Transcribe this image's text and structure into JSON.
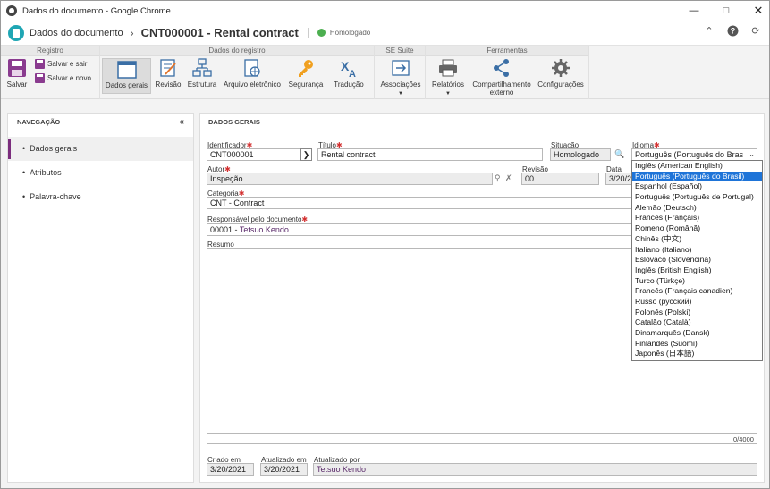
{
  "window": {
    "title": "Dados do documento - Google Chrome"
  },
  "header": {
    "app_name": "Dados do documento",
    "doc_title": "CNT000001 - Rental contract",
    "status": "Homologado"
  },
  "ribbon": {
    "groups": {
      "registro": "Registro",
      "dados": "Dados do registro",
      "suite": "SE Suite",
      "ferramentas": "Ferramentas"
    },
    "save": "Salvar",
    "save_exit": "Salvar e sair",
    "save_new": "Salvar e novo",
    "general": "Dados gerais",
    "revision": "Revisão",
    "structure": "Estrutura",
    "electronic_file": "Arquivo eletrônico",
    "security": "Segurança",
    "translation": "Tradução",
    "associations": "Associações",
    "reports": "Relatórios",
    "sharing_line1": "Compartilhamento",
    "sharing_line2": "externo",
    "settings": "Configurações"
  },
  "nav": {
    "title": "NAVEGAÇÃO",
    "items": [
      "Dados gerais",
      "Atributos",
      "Palavra-chave"
    ]
  },
  "form": {
    "section_title": "DADOS GERAIS",
    "identifier_label": "Identificador",
    "identifier": "CNT000001",
    "title_label": "Título",
    "title": "Rental contract",
    "situation_label": "Situação",
    "situation": "Homologado",
    "language_label": "Idioma",
    "language": "Português (Português do Bras",
    "author_label": "Autor",
    "author": "Inspeção",
    "revision_label": "Revisão",
    "revision": "00",
    "date_label": "Data",
    "date": "3/20/2",
    "category_label": "Categoria",
    "category": "CNT - Contract",
    "responsible_label": "Responsável pelo documento",
    "responsible_code": "00001 - ",
    "responsible_name": "Tetsuo Kendo",
    "summary_label": "Resumo",
    "summary_counter": "0/4000",
    "created_label": "Criado em",
    "created": "3/20/2021",
    "updated_label": "Atualizado em",
    "updated": "3/20/2021",
    "updated_by_label": "Atualizado por",
    "updated_by": "Tetsuo Kendo"
  },
  "language_options": [
    "Inglês (American English)",
    "Português (Português do Brasil)",
    "Espanhol (Español)",
    "Português (Português de Portugal)",
    "Alemão (Deutsch)",
    "Francês (Français)",
    "Romeno (Română)",
    "Chinês (中文)",
    "Italiano (Italiano)",
    "Eslovaco (Slovencina)",
    "Inglês (British English)",
    "Turco (Türkçe)",
    "Francês (Français canadien)",
    "Russo (русский)",
    "Polonês (Polski)",
    "Catalão (Català)",
    "Dinamarquês (Dansk)",
    "Finlandês (Suomi)",
    "Japonês (日本語)"
  ],
  "colors": {
    "accent": "#7b2d7d",
    "selected": "#1e74d8",
    "brand": "#1fa6b4"
  }
}
